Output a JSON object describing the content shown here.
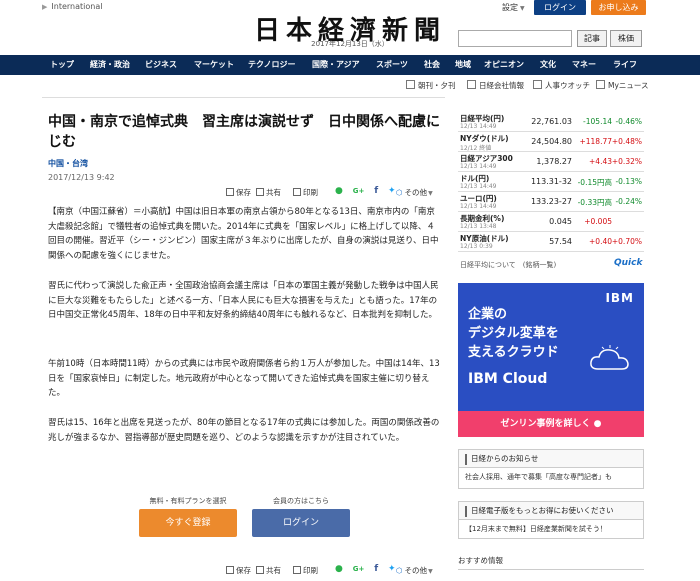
{
  "top": {
    "international": "International",
    "settings": "設定",
    "login": "ログイン",
    "signup": "お申し込み"
  },
  "masthead": {
    "logo": "日本経濟新聞",
    "date": "2017年12月13日（水）"
  },
  "search": {
    "value": "",
    "article_button": "記事",
    "stock_button": "株価"
  },
  "nav": {
    "items": [
      "トップ",
      "経済・政治",
      "ビジネス",
      "マーケット",
      "テクノロジー",
      "国際・アジア",
      "スポーツ",
      "社会",
      "地域",
      "オピニオン",
      "文化",
      "マネー",
      "ライフ"
    ]
  },
  "subnav": {
    "items": [
      "朝刊・夕刊",
      "日経会社情報",
      "人事ウオッチ",
      "Myニュース"
    ]
  },
  "article": {
    "headline": "中国・南京で追悼式典　習主席は演説せず　日中関係へ配慮にじむ",
    "category": "中国・台湾",
    "datetime": "2017/12/13 9:42",
    "share": {
      "save": "保存",
      "share": "共有",
      "print": "印刷",
      "other": "その他"
    },
    "paragraphs": [
      "【南京（中国江蘇省）＝小高航】中国は旧日本軍の南京占領から80年となる13日、南京市内の「南京大虐殺記念館」で犠牲者の追悼式典を開いた。2014年に式典を「国家レベル」に格上げして以降、４回目の開催。習近平（シー・ジンピン）国家主席が３年ぶりに出席したが、自身の演説は見送り、日中関係への配慮を強くにじませた。",
      "習氏に代わって演説した兪正声・全国政治協商会議主席は「日本の軍国主義が発動した戦争は中国人民に巨大な災難をもたらした」と述べる一方、「日本人民にも巨大な損害を与えた」とも語った。17年の日中国交正常化45周年、18年の日中平和友好条約締結40周年にも触れるなど、日本批判を抑制した。",
      "午前10時（日本時間11時）からの式典には市民や政府関係者ら約１万人が参加した。中国は14年、13日を「国家哀悼日」に制定した。地元政府が中心となって開いてきた追悼式典を国家主催に切り替えた。",
      "習氏は15、16年と出席を見送ったが、80年の節目となる17年の式典には参加した。両国の関係改善の兆しが強まるなか、習指導部が歴史問題を巡り、どのような認識を示すかが注目されていた。"
    ],
    "gate": {
      "plan_label": "無料・有料プランを選択",
      "member_label": "会員の方はこちら",
      "register_button": "今すぐ登録",
      "login_button": "ログイン"
    }
  },
  "market": {
    "rows": [
      {
        "name": "日経平均(円)",
        "time": "12/13 14:49",
        "value": "22,761.03",
        "change": "-105.14",
        "pct": "-0.46%",
        "dir": "down"
      },
      {
        "name": "NYダウ(ドル)",
        "time": "12/12 終値",
        "value": "24,504.80",
        "change": "+118.77",
        "pct": "+0.48%",
        "dir": "up"
      },
      {
        "name": "日経アジア300",
        "time": "12/13 14:49",
        "value": "1,378.27",
        "change": "+4.43",
        "pct": "+0.32%",
        "dir": "up"
      },
      {
        "name": "ドル(円)",
        "time": "12/13 14:49",
        "value": "113.31-32",
        "change": "-0.15円高",
        "pct": "-0.13%",
        "dir": "down"
      },
      {
        "name": "ユーロ(円)",
        "time": "12/13 14:49",
        "value": "133.23-27",
        "change": "-0.33円高",
        "pct": "-0.24%",
        "dir": "down"
      },
      {
        "name": "長期金利(%)",
        "time": "12/13 13:48",
        "value": "0.045",
        "change": "+0.005",
        "pct": "",
        "dir": "up"
      },
      {
        "name": "NY原油(ドル)",
        "time": "12/13 0:39",
        "value": "57.54",
        "change": "+0.40",
        "pct": "+0.70%",
        "dir": "up"
      }
    ],
    "note": "日経平均について　(銘柄一覧)",
    "quick_logo": "Quick"
  },
  "ad": {
    "logo": "IBM",
    "copy_line1": "企業の",
    "copy_line2": "デジタル変革を",
    "copy_line3": "支えるクラウド",
    "product": "IBM Cloud",
    "cta": "ゼンリン事例を詳しく ●"
  },
  "notices": [
    {
      "title": "日経からのお知らせ",
      "body": "社会人採用、通年で募集「高度な専門記者」も"
    },
    {
      "title": "日経電子版をもっとお得にお使いください",
      "body": "【12月末まで無料】日経産業新聞を試そう！"
    }
  ],
  "recommend": {
    "title": "おすすめ情報"
  },
  "colors": {
    "nav_bg": "#0b2b57",
    "login_bg": "#0d3f83",
    "signup_bg": "#ec7b1b",
    "up": "#d40d12",
    "down": "#108a2c",
    "ad_bg": "#2a4ec2",
    "ad_cta": "#f13f6c"
  }
}
